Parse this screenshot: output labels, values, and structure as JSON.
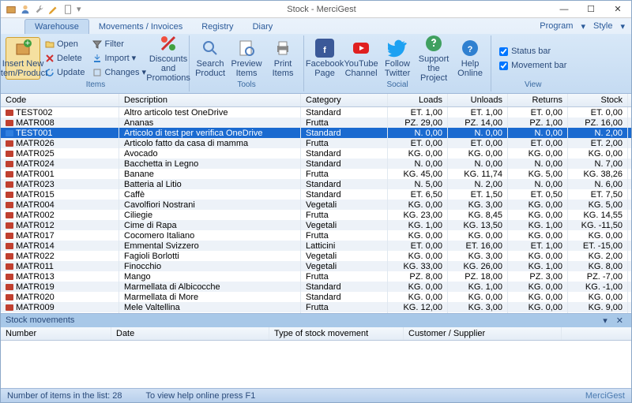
{
  "window": {
    "title": "Stock - MerciGest"
  },
  "qat_icons": [
    "box-icon",
    "user-icon",
    "wrench-icon",
    "pencil-icon",
    "page-icon"
  ],
  "tabs": [
    "Warehouse",
    "Movements / Invoices",
    "Registry",
    "Diary"
  ],
  "right_menu": {
    "program": "Program",
    "style": "Style"
  },
  "ribbon": {
    "insert": "Insert New\nItem/Product",
    "open": "Open",
    "delete": "Delete",
    "update": "Update",
    "filter": "Filter",
    "import": "Import",
    "changes": "Changes",
    "group_items": "Items",
    "discounts": "Discounts and\nPromotions",
    "search": "Search\nProduct",
    "preview": "Preview\nItems",
    "print": "Print\nItems",
    "group_tools": "Tools",
    "facebook": "Facebook\nPage",
    "youtube": "YouTube\nChannel",
    "twitter": "Follow\nTwitter",
    "support": "Support\nthe Project",
    "help": "Help\nOnline",
    "group_social": "Social",
    "statusbar": "Status bar",
    "movementbar": "Movement bar",
    "group_view": "View"
  },
  "cols": [
    "Code",
    "Description",
    "Category",
    "Loads",
    "Unloads",
    "Returns",
    "Stock"
  ],
  "rows": [
    {
      "code": "TEST002",
      "desc": "Altro articolo test OneDrive",
      "cat": "Standard",
      "l": "ET. 1,00",
      "u": "ET. 1,00",
      "r": "ET. 0,00",
      "s": "ET. 0,00"
    },
    {
      "code": "MATR008",
      "desc": "Ananas",
      "cat": "Frutta",
      "l": "PZ. 29,00",
      "u": "PZ. 14,00",
      "r": "PZ. 1,00",
      "s": "PZ. 16,00"
    },
    {
      "code": "TEST001",
      "desc": "Articolo di test per verifica OneDrive",
      "cat": "Standard",
      "l": "N. 0,00",
      "u": "N. 0,00",
      "r": "N. 0,00",
      "s": "N. 2,00",
      "sel": true
    },
    {
      "code": "MATR026",
      "desc": "Articolo fatto da casa di mamma",
      "cat": "Frutta",
      "l": "ET. 0,00",
      "u": "ET. 0,00",
      "r": "ET. 0,00",
      "s": "ET. 2,00"
    },
    {
      "code": "MATR025",
      "desc": "Avocado",
      "cat": "Standard",
      "l": "KG. 0,00",
      "u": "KG. 0,00",
      "r": "KG. 0,00",
      "s": "KG. 0,00"
    },
    {
      "code": "MATR024",
      "desc": "Bacchetta in Legno",
      "cat": "Standard",
      "l": "N. 0,00",
      "u": "N. 0,00",
      "r": "N. 0,00",
      "s": "N. 7,00"
    },
    {
      "code": "MATR001",
      "desc": "Banane",
      "cat": "Frutta",
      "l": "KG. 45,00",
      "u": "KG. 11,74",
      "r": "KG. 5,00",
      "s": "KG. 38,26"
    },
    {
      "code": "MATR023",
      "desc": "Batteria al Litio",
      "cat": "Standard",
      "l": "N. 5,00",
      "u": "N. 2,00",
      "r": "N. 0,00",
      "s": "N. 6,00"
    },
    {
      "code": "MATR015",
      "desc": "Caffè",
      "cat": "Standard",
      "l": "ET. 6,50",
      "u": "ET. 1,50",
      "r": "ET. 0,50",
      "s": "ET. 7,50"
    },
    {
      "code": "MATR004",
      "desc": "Cavolfiori Nostrani",
      "cat": "Vegetali",
      "l": "KG. 0,00",
      "u": "KG. 3,00",
      "r": "KG. 0,00",
      "s": "KG. 5,00"
    },
    {
      "code": "MATR002",
      "desc": "Ciliegie",
      "cat": "Frutta",
      "l": "KG. 23,00",
      "u": "KG. 8,45",
      "r": "KG. 0,00",
      "s": "KG. 14,55"
    },
    {
      "code": "MATR012",
      "desc": "Cime di Rapa",
      "cat": "Vegetali",
      "l": "KG. 1,00",
      "u": "KG. 13,50",
      "r": "KG. 1,00",
      "s": "KG. -11,50"
    },
    {
      "code": "MATR017",
      "desc": "Cocomero Italiano",
      "cat": "Frutta",
      "l": "KG. 0,00",
      "u": "KG. 0,00",
      "r": "KG. 0,00",
      "s": "KG. 0,00"
    },
    {
      "code": "MATR014",
      "desc": "Emmental Svizzero",
      "cat": "Latticini",
      "l": "ET. 0,00",
      "u": "ET. 16,00",
      "r": "ET. 1,00",
      "s": "ET. -15,00"
    },
    {
      "code": "MATR022",
      "desc": "Fagioli Borlotti",
      "cat": "Vegetali",
      "l": "KG. 0,00",
      "u": "KG. 3,00",
      "r": "KG. 0,00",
      "s": "KG. 2,00"
    },
    {
      "code": "MATR011",
      "desc": "Finocchio",
      "cat": "Vegetali",
      "l": "KG. 33,00",
      "u": "KG. 26,00",
      "r": "KG. 1,00",
      "s": "KG. 8,00"
    },
    {
      "code": "MATR013",
      "desc": "Mango",
      "cat": "Frutta",
      "l": "PZ. 8,00",
      "u": "PZ. 18,00",
      "r": "PZ. 3,00",
      "s": "PZ. -7,00"
    },
    {
      "code": "MATR019",
      "desc": "Marmellata di Albicocche",
      "cat": "Standard",
      "l": "KG. 0,00",
      "u": "KG. 1,00",
      "r": "KG. 0,00",
      "s": "KG. -1,00"
    },
    {
      "code": "MATR020",
      "desc": "Marmellata di More",
      "cat": "Standard",
      "l": "KG. 0,00",
      "u": "KG. 0,00",
      "r": "KG. 0,00",
      "s": "KG. 0,00"
    },
    {
      "code": "MATR009",
      "desc": "Mele Valtellina",
      "cat": "Frutta",
      "l": "KG. 12,00",
      "u": "KG. 3,00",
      "r": "KG. 0,00",
      "s": "KG. 9,00"
    }
  ],
  "detail": {
    "title": "Stock movements",
    "cols": [
      "Number",
      "Date",
      "Type of stock movement",
      "Customer / Supplier"
    ]
  },
  "status": {
    "count": "Number of items in the list: 28",
    "help": "To view help online press F1",
    "app": "MerciGest"
  }
}
